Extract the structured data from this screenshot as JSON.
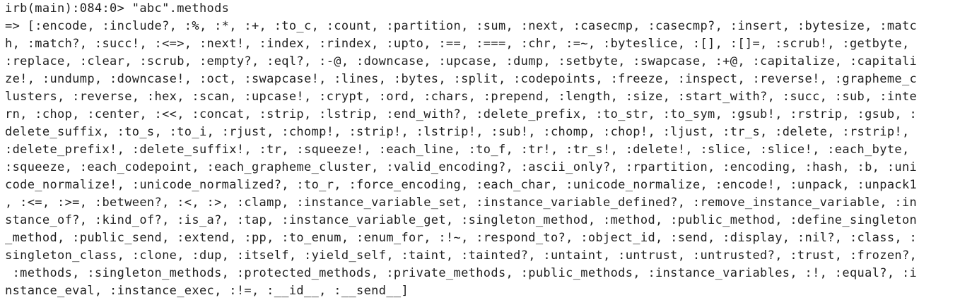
{
  "terminal": {
    "lines": [
      "irb(main):084:0> \"abc\".methods",
      "=> [:encode, :include?, :%, :*, :+, :to_c, :count, :partition, :sum, :next, :casecmp, :casecmp?, :insert, :bytesize, :matc",
      "h, :match?, :succ!, :<=>, :next!, :index, :rindex, :upto, :==, :===, :chr, :=~, :byteslice, :[], :[]=, :scrub!, :getbyte,",
      ":replace, :clear, :scrub, :empty?, :eql?, :-@, :downcase, :upcase, :dump, :setbyte, :swapcase, :+@, :capitalize, :capitali",
      "ze!, :undump, :downcase!, :oct, :swapcase!, :lines, :bytes, :split, :codepoints, :freeze, :inspect, :reverse!, :grapheme_c",
      "lusters, :reverse, :hex, :scan, :upcase!, :crypt, :ord, :chars, :prepend, :length, :size, :start_with?, :succ, :sub, :inte",
      "rn, :chop, :center, :<<, :concat, :strip, :lstrip, :end_with?, :delete_prefix, :to_str, :to_sym, :gsub!, :rstrip, :gsub, :",
      "delete_suffix, :to_s, :to_i, :rjust, :chomp!, :strip!, :lstrip!, :sub!, :chomp, :chop!, :ljust, :tr_s, :delete, :rstrip!,",
      ":delete_prefix!, :delete_suffix!, :tr, :squeeze!, :each_line, :to_f, :tr!, :tr_s!, :delete!, :slice, :slice!, :each_byte,",
      ":squeeze, :each_codepoint, :each_grapheme_cluster, :valid_encoding?, :ascii_only?, :rpartition, :encoding, :hash, :b, :uni",
      "code_normalize!, :unicode_normalized?, :to_r, :force_encoding, :each_char, :unicode_normalize, :encode!, :unpack, :unpack1",
      ", :<=, :>=, :between?, :<, :>, :clamp, :instance_variable_set, :instance_variable_defined?, :remove_instance_variable, :in",
      "stance_of?, :kind_of?, :is_a?, :tap, :instance_variable_get, :singleton_method, :method, :public_method, :define_singleton",
      "_method, :public_send, :extend, :pp, :to_enum, :enum_for, :!~, :respond_to?, :object_id, :send, :display, :nil?, :class, :",
      "singleton_class, :clone, :dup, :itself, :yield_self, :taint, :tainted?, :untaint, :untrust, :untrusted?, :trust, :frozen?,",
      " :methods, :singleton_methods, :protected_methods, :private_methods, :public_methods, :instance_variables, :!, :equal?, :i",
      "nstance_eval, :instance_exec, :!=, :__id__, :__send__]"
    ]
  }
}
